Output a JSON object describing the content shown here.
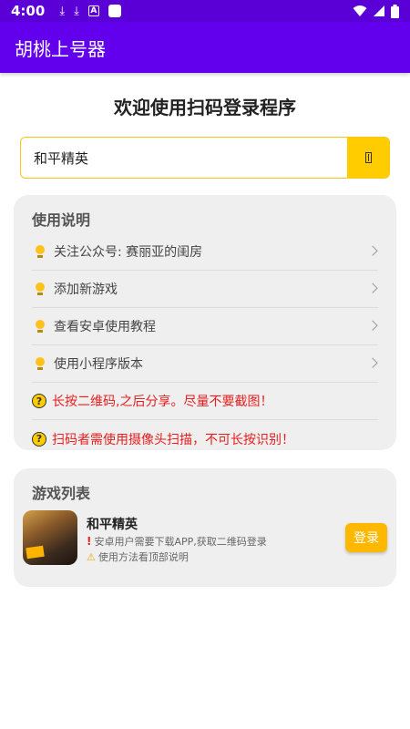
{
  "status_bar": {
    "time": "4:00",
    "icons": [
      "download-icon",
      "download-icon",
      "font-app-icon",
      "app-square-icon"
    ],
    "right_icons": [
      "wifi-icon",
      "signal-icon",
      "battery-icon"
    ],
    "color": "#5a00d6"
  },
  "app_bar": {
    "title": "胡桃上号器",
    "color": "#6200ee"
  },
  "welcome": "欢迎使用扫码登录程序",
  "search": {
    "value": "和平精英",
    "button_icon": "search-icon",
    "accent": "#ffcc00"
  },
  "usage": {
    "title": "使用说明",
    "items": [
      {
        "text": "关注公众号: 赛丽亚的闺房",
        "icon": "bulb-icon",
        "chevron": true
      },
      {
        "text": "添加新游戏",
        "icon": "bulb-icon",
        "chevron": true
      },
      {
        "text": "查看安卓使用教程",
        "icon": "bulb-icon",
        "chevron": true
      },
      {
        "text": "使用小程序版本",
        "icon": "bulb-icon",
        "chevron": true
      },
      {
        "text": "长按二维码,之后分享。尽量不要截图！",
        "icon": "warning-icon",
        "chevron": false
      },
      {
        "text": "扫码者需使用摄像头扫描，不可长按识别！",
        "icon": "warning-icon",
        "chevron": false
      }
    ]
  },
  "games": {
    "title": "游戏列表",
    "items": [
      {
        "name": "和平精英",
        "note1": "安卓用户需要下载APP,获取二维码登录",
        "note2": "使用方法看顶部说明",
        "login_label": "登录"
      }
    ]
  }
}
